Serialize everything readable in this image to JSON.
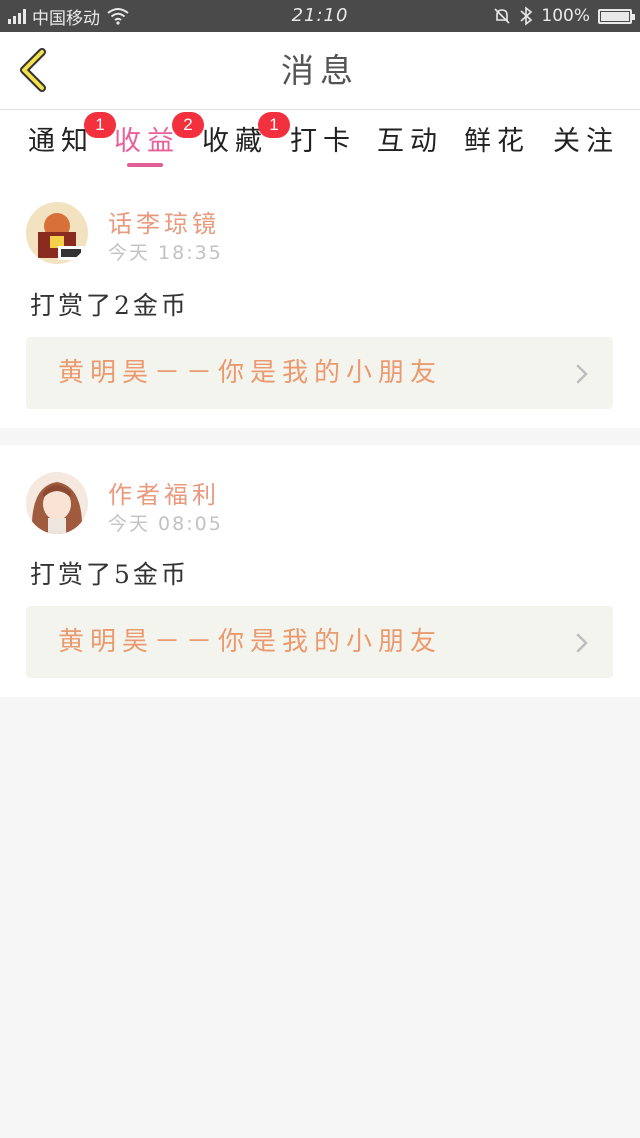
{
  "statusbar": {
    "carrier": "中国移动",
    "time": "21:10",
    "battery": "100%",
    "battery_level": 1.0
  },
  "header": {
    "title": "消息",
    "back_icon": "chevron-left-icon"
  },
  "tabs": [
    {
      "label": "通知",
      "badge": ""
    },
    {
      "label": "收益",
      "badge": "1",
      "active": true
    },
    {
      "label": "收藏",
      "badge": "2"
    },
    {
      "label": "打卡",
      "badge": "1"
    },
    {
      "label": "互动",
      "badge": ""
    },
    {
      "label": "鲜花",
      "badge": ""
    },
    {
      "label": "关注",
      "badge": ""
    }
  ],
  "messages": [
    {
      "username": "话李琼镜",
      "time": "今天 18:35",
      "text": "打赏了2金币",
      "book": "黄明昊－－你是我的小朋友"
    },
    {
      "username": "作者福利",
      "time": "今天 08:05",
      "text": "打赏了5金币",
      "book": "黄明昊－－你是我的小朋友"
    }
  ],
  "colors": {
    "accent": "#e8609a",
    "badge": "#f3303e",
    "username": "#e99a7e",
    "book_link": "#ea9a6e"
  }
}
